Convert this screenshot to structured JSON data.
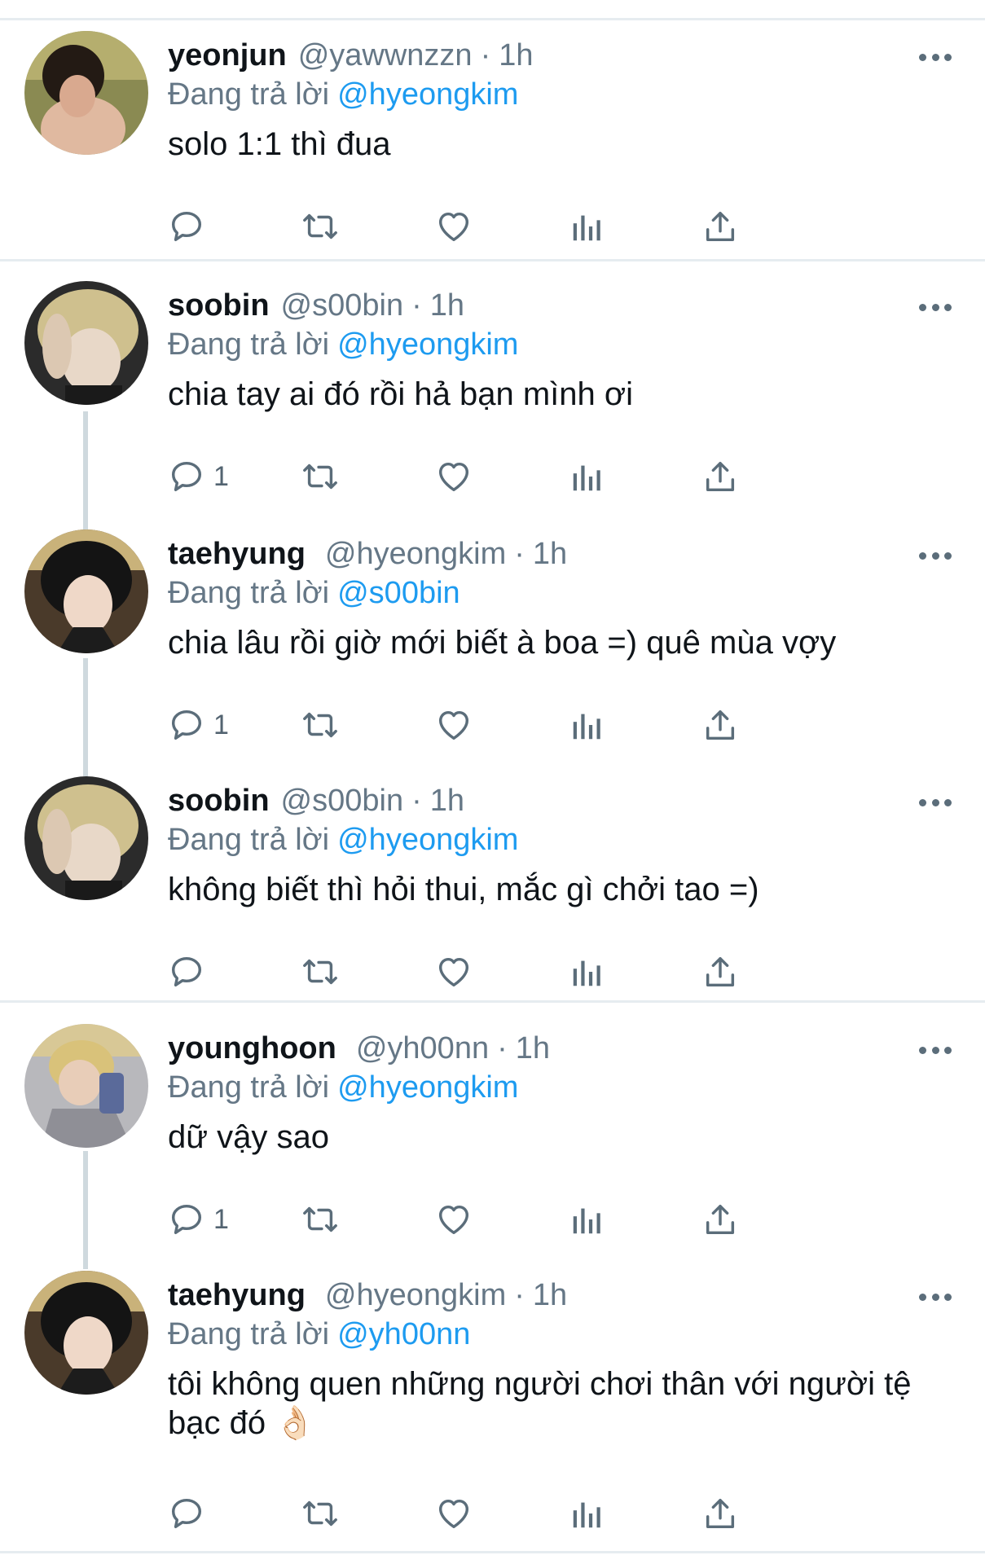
{
  "colors": {
    "text": "#0f1419",
    "secondary": "#657786",
    "mention": "#1d9bf0",
    "icon": "#5b6d7a",
    "separator": "#e6ecf0",
    "thread_line": "#cfd9de"
  },
  "reply_prefix": "Đang trả lời",
  "tweets": [
    {
      "name": "yeonjun",
      "handle": "@yawwnzzn",
      "separator": "·",
      "time": "1h",
      "reply_to": "@hyeongkim",
      "text": "solo 1:1 thì đua",
      "reply_count": ""
    },
    {
      "name": "soobin",
      "handle": "@s00bin",
      "separator": "·",
      "time": "1h",
      "reply_to": "@hyeongkim",
      "text": "chia tay ai đó rồi hả bạn mình ơi",
      "reply_count": "1"
    },
    {
      "name": "taehyung",
      "handle": "@hyeongkim",
      "separator": "·",
      "time": "1h",
      "reply_to": "@s00bin",
      "text": "chia lâu rồi giờ mới biết à boa =) quê mùa vợy",
      "reply_count": "1"
    },
    {
      "name": "soobin",
      "handle": "@s00bin",
      "separator": "·",
      "time": "1h",
      "reply_to": "@hyeongkim",
      "text": "không biết thì hỏi thui, mắc gì chởi tao =)",
      "reply_count": ""
    },
    {
      "name": "younghoon",
      "handle": "@yh00nn",
      "separator": "·",
      "time": "1h",
      "reply_to": "@hyeongkim",
      "text": "dữ vậy sao",
      "reply_count": "1"
    },
    {
      "name": "taehyung",
      "handle": "@hyeongkim",
      "separator": "·",
      "time": "1h",
      "reply_to": "@yh00nn",
      "text": "tôi không quen những người chơi thân với người tệ bạc đó 👌🏻",
      "reply_count": ""
    }
  ]
}
